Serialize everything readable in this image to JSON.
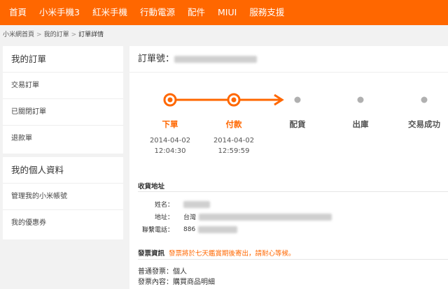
{
  "nav": {
    "items": [
      "首頁",
      "小米手機3",
      "紅米手機",
      "行動電源",
      "配件",
      "MIUI",
      "服務支援"
    ]
  },
  "breadcrumb": {
    "home": "小米網首頁",
    "orders": "我的訂單",
    "current": "訂單詳情"
  },
  "sidebar": {
    "orders_title": "我的訂單",
    "order_items": [
      "交易訂單",
      "已關閉訂單",
      "退款單"
    ],
    "profile_title": "我的個人資料",
    "profile_items": [
      "管理我的小米帳號",
      "我的優惠券"
    ]
  },
  "order": {
    "number_label": "訂單號："
  },
  "progress": {
    "steps": [
      {
        "label": "下單",
        "date": "2014-04-02",
        "time": "12:04:30",
        "done": true
      },
      {
        "label": "付款",
        "date": "2014-04-02",
        "time": "12:59:59",
        "done": true
      },
      {
        "label": "配貨",
        "done": false
      },
      {
        "label": "出庫",
        "done": false
      },
      {
        "label": "交易成功",
        "done": false
      }
    ],
    "colors": {
      "done": "#ff6700",
      "todo": "#b0b0b0"
    }
  },
  "shipping": {
    "title": "收貨地址",
    "name_label": "姓名：",
    "address_label": "地址：",
    "address_prefix": "台灣",
    "phone_label": "聯繫電話：",
    "phone_prefix": "886"
  },
  "invoice": {
    "title": "發票資訊",
    "note": "發票將於七天鑑賞期後寄出，請耐心等候。",
    "type_line": "普通發票：個人",
    "content_line": "發票內容：購買商品明細"
  },
  "colors": {
    "accent": "#ff6700",
    "background": "#f2f2f2"
  }
}
